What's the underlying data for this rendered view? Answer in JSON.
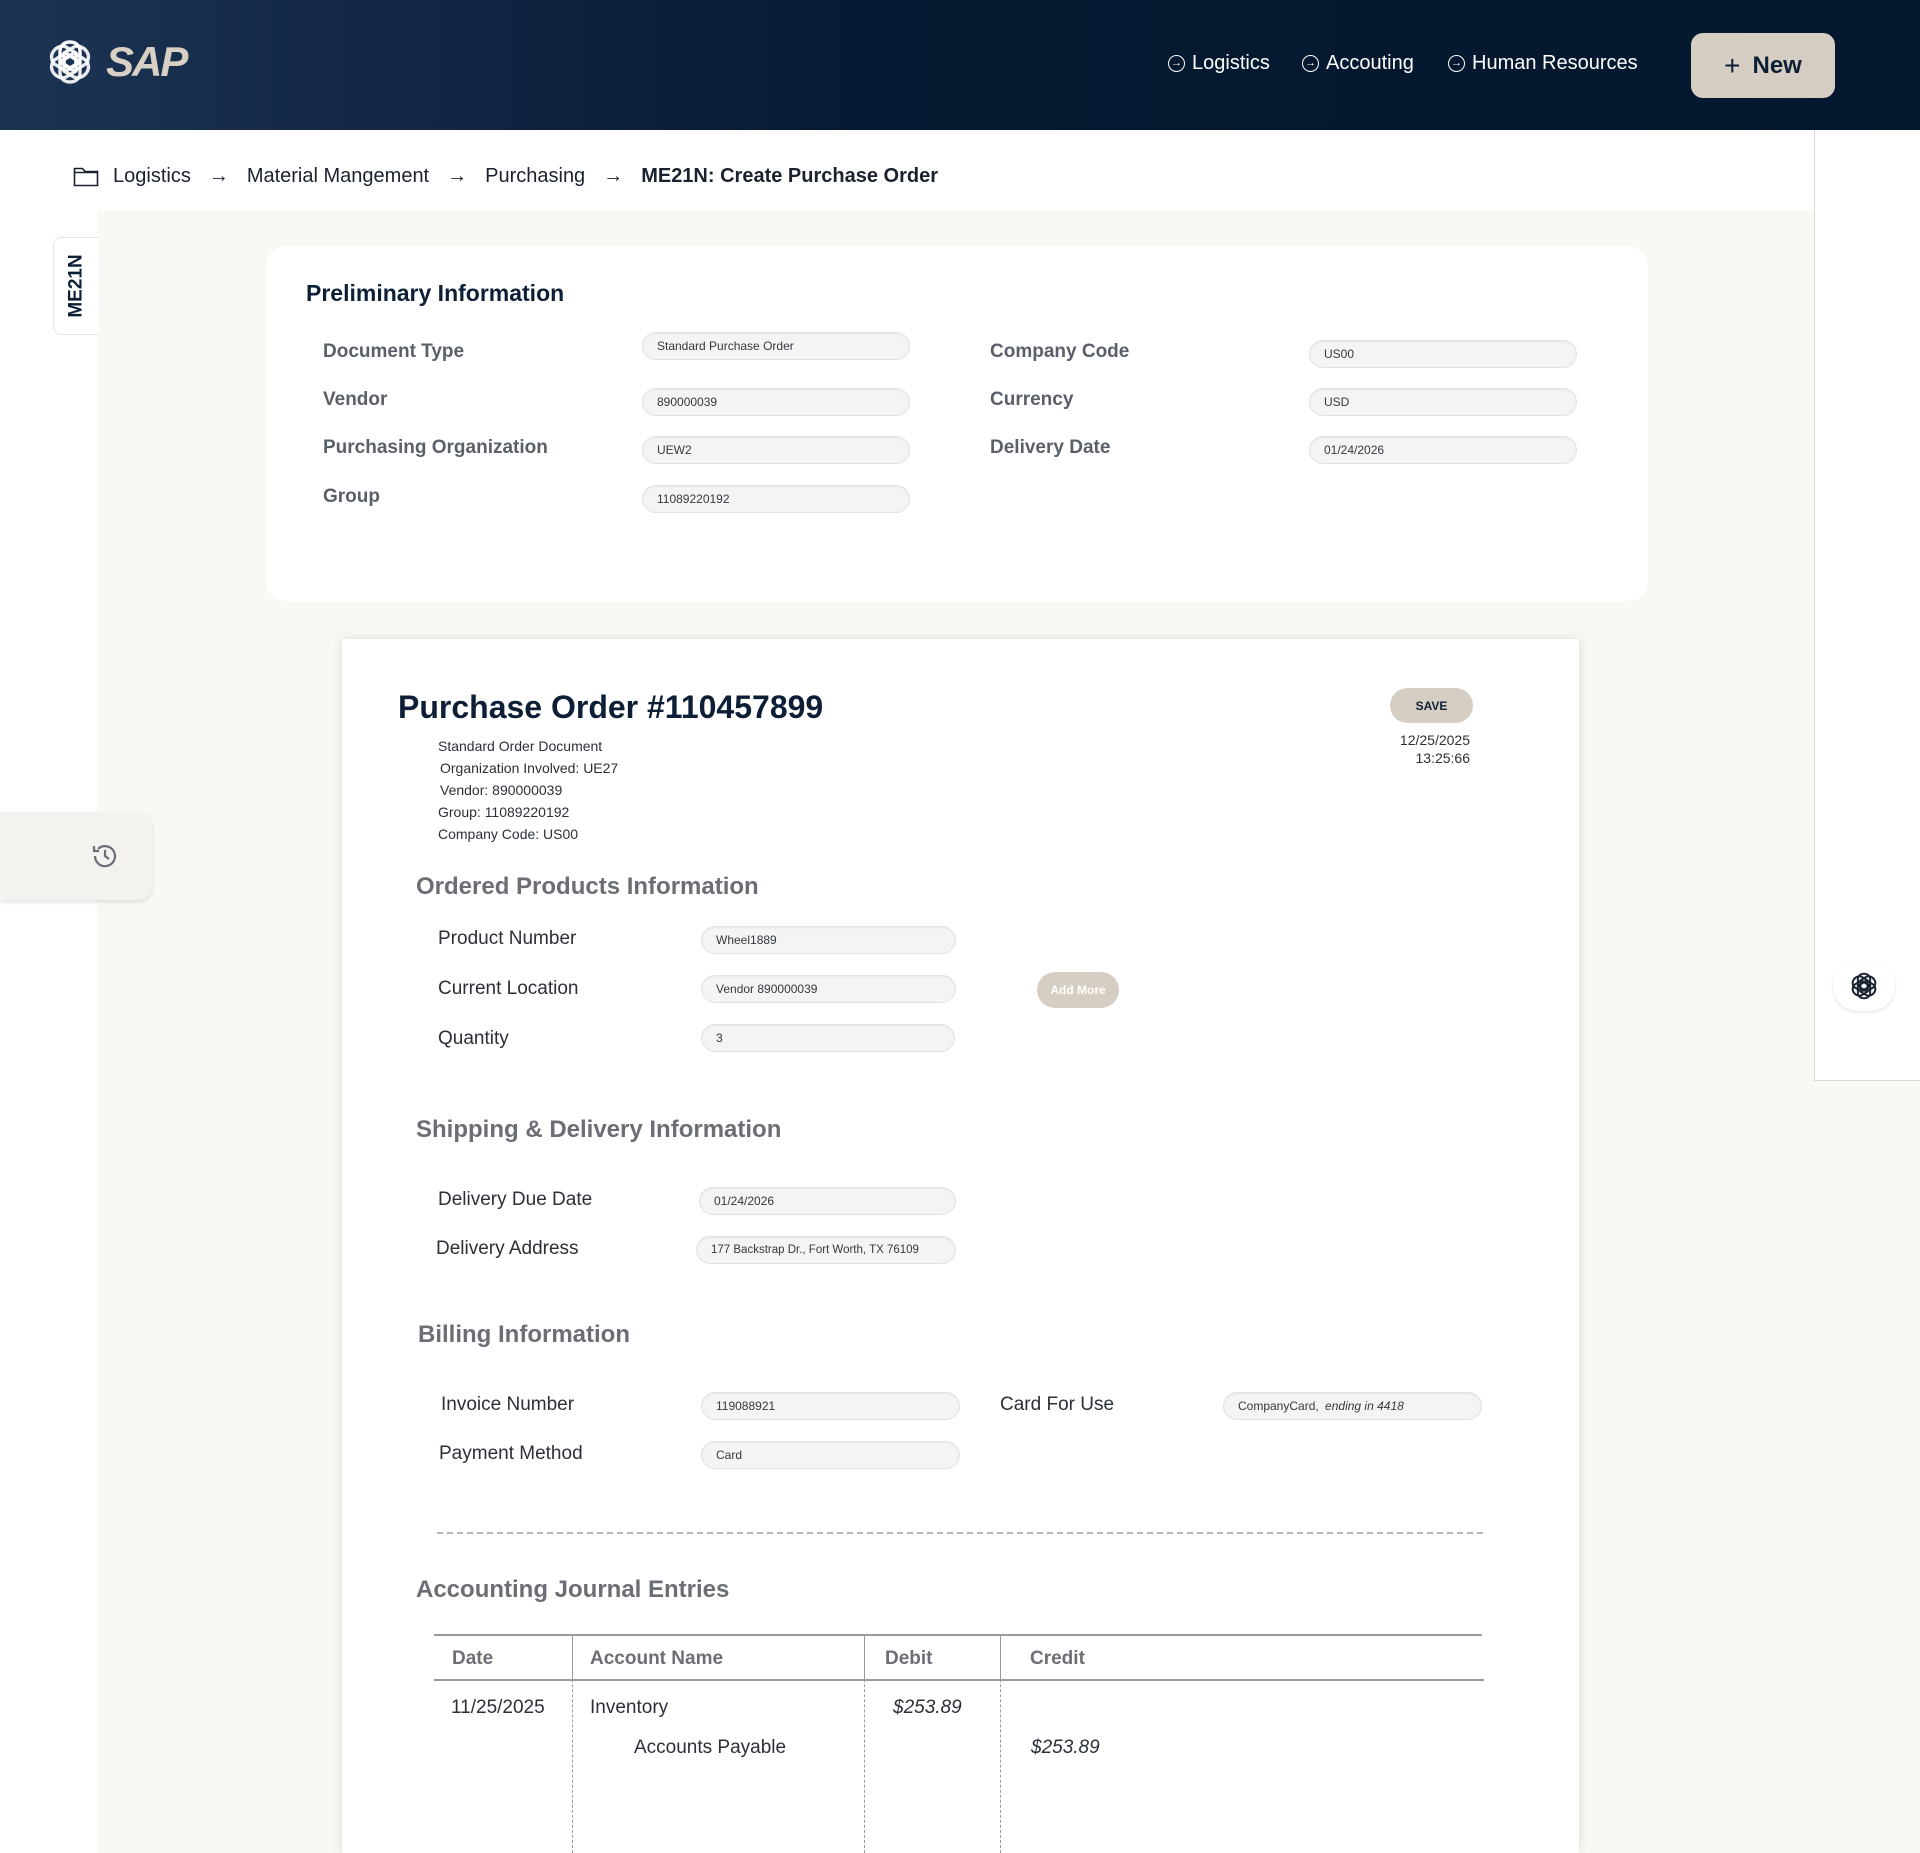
{
  "header": {
    "brand": "SAP",
    "nav": [
      {
        "label": "Logistics",
        "icon": "arrow-circle-icon"
      },
      {
        "label": "Accouting",
        "icon": "arrow-circle-icon"
      },
      {
        "label": "Human Resources",
        "icon": "arrow-circle-icon"
      }
    ],
    "new_button": "New"
  },
  "breadcrumb": {
    "items": [
      "Logistics",
      "Material Mangement",
      "Purchasing"
    ],
    "current": "ME21N: Create Purchase Order"
  },
  "side_tab": "ME21N",
  "preliminary": {
    "title": "Preliminary Information",
    "left": [
      {
        "label": "Document Type",
        "value": "Standard Purchase Order"
      },
      {
        "label": "Vendor",
        "value": "890000039"
      },
      {
        "label": "Purchasing Organization",
        "value": "UEW2"
      },
      {
        "label": "Group",
        "value": "11089220192"
      }
    ],
    "right": [
      {
        "label": "Company Code",
        "value": "US00"
      },
      {
        "label": "Currency",
        "value": "USD"
      },
      {
        "label": "Delivery Date",
        "value": "01/24/2026"
      }
    ]
  },
  "purchase_order": {
    "title": "Purchase Order #110457899",
    "meta": [
      "Standard Order Document",
      "Organization Involved: UE27",
      "Vendor: 890000039",
      "Group: 11089220192",
      "Company Code: US00"
    ],
    "save_label": "SAVE",
    "date": "12/25/2025",
    "time": "13:25:66",
    "products": {
      "title": "Ordered Products Information",
      "product_number_label": "Product Number",
      "product_number": "Wheel1889",
      "current_location_label": "Current Location",
      "current_location": "Vendor 890000039",
      "quantity_label": "Quantity",
      "quantity": "3",
      "add_more": "Add More"
    },
    "shipping": {
      "title": "Shipping & Delivery Information",
      "due_date_label": "Delivery Due Date",
      "due_date": "01/24/2026",
      "address_label": "Delivery Address",
      "address": "177 Backstrap Dr., Fort Worth, TX 76109"
    },
    "billing": {
      "title": "Billing Information",
      "invoice_label": "Invoice Number",
      "invoice": "119088921",
      "payment_label": "Payment Method",
      "payment": "Card",
      "card_label": "Card For Use",
      "card_name": "CompanyCard, ",
      "card_ending": "ending in 4418"
    },
    "journal": {
      "title": "Accounting Journal Entries",
      "columns": [
        "Date",
        "Account Name",
        "Debit",
        "Credit"
      ],
      "rows": [
        {
          "date": "11/25/2025",
          "account": "Inventory",
          "debit": "$253.89",
          "credit": ""
        },
        {
          "date": "",
          "account": "Accounts Payable",
          "debit": "",
          "credit": "$253.89"
        }
      ]
    }
  }
}
